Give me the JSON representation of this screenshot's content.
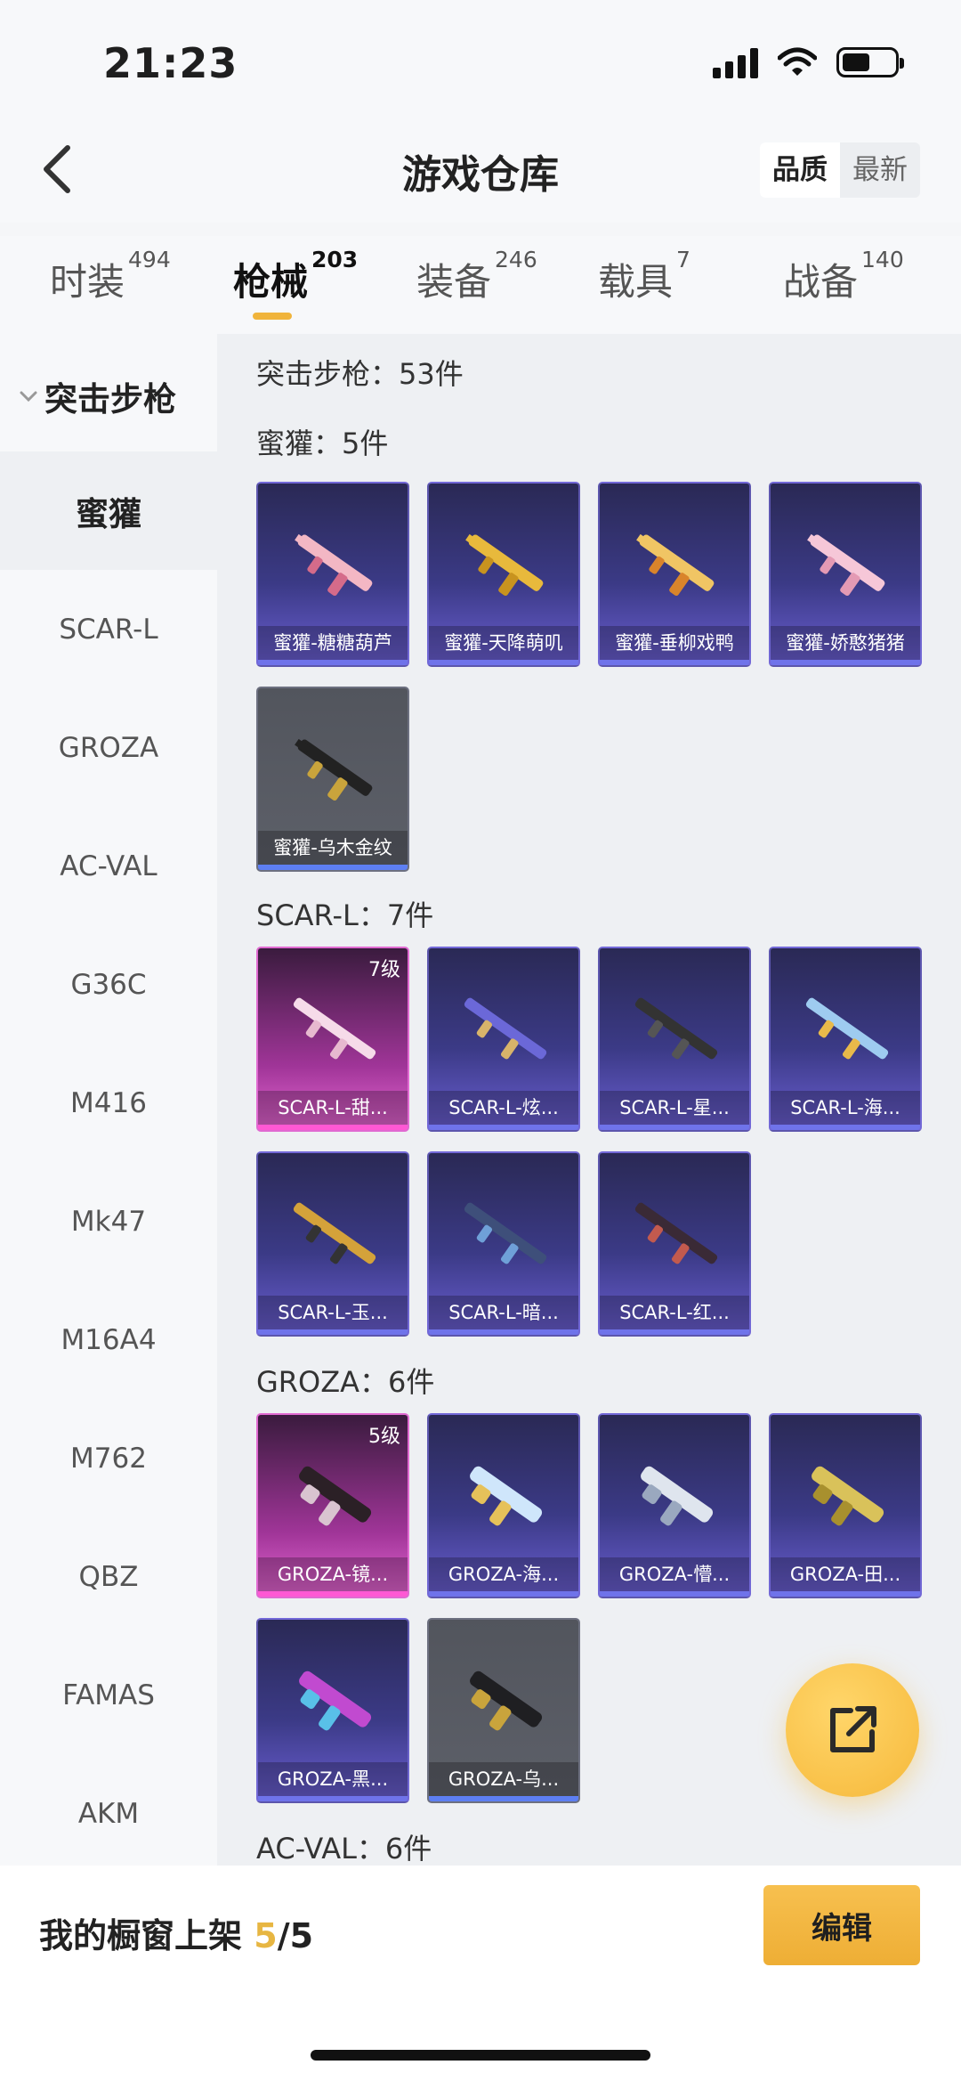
{
  "status": {
    "time": "21:23"
  },
  "header": {
    "title": "游戏仓库",
    "sort_options": [
      "品质",
      "最新"
    ],
    "active_sort": "品质"
  },
  "tabs": [
    {
      "label": "时装",
      "count": "494"
    },
    {
      "label": "枪械",
      "count": "203",
      "active": true
    },
    {
      "label": "装备",
      "count": "246"
    },
    {
      "label": "载具",
      "count": "7"
    },
    {
      "label": "战备",
      "count": "140"
    }
  ],
  "sidebar": {
    "category": "突击步枪",
    "items": [
      "蜜獾",
      "SCAR-L",
      "GROZA",
      "AC-VAL",
      "G36C",
      "M416",
      "Mk47",
      "M16A4",
      "M762",
      "QBZ",
      "FAMAS",
      "AKM"
    ],
    "active_index": 0
  },
  "main": {
    "sections": [
      {
        "title": "突击步枪：53件"
      },
      {
        "title": "蜜獾：5件"
      },
      {
        "title": "SCAR-L：7件"
      },
      {
        "title": "GROZA：6件"
      },
      {
        "title": "AC-VAL：6件"
      }
    ],
    "cards": {
      "mihuan": [
        {
          "name": "蜜獾-糖糖葫芦"
        },
        {
          "name": "蜜獾-天降萌叽"
        },
        {
          "name": "蜜獾-垂柳戏鸭"
        },
        {
          "name": "蜜獾-娇憨猪猪"
        },
        {
          "name": "蜜獾-乌木金纹"
        }
      ],
      "scar": [
        {
          "name": "SCAR-L-甜...",
          "level": "7级"
        },
        {
          "name": "SCAR-L-炫..."
        },
        {
          "name": "SCAR-L-星..."
        },
        {
          "name": "SCAR-L-海..."
        },
        {
          "name": "SCAR-L-玉..."
        },
        {
          "name": "SCAR-L-暗..."
        },
        {
          "name": "SCAR-L-红..."
        }
      ],
      "groza": [
        {
          "name": "GROZA-镜...",
          "level": "5级"
        },
        {
          "name": "GROZA-海..."
        },
        {
          "name": "GROZA-懵..."
        },
        {
          "name": "GROZA-田..."
        },
        {
          "name": "GROZA-黑..."
        },
        {
          "name": "GROZA-乌..."
        }
      ]
    }
  },
  "bottom": {
    "label": "我的橱窗上架",
    "count_current": "5",
    "count_total": "/5",
    "edit_label": "编辑"
  }
}
